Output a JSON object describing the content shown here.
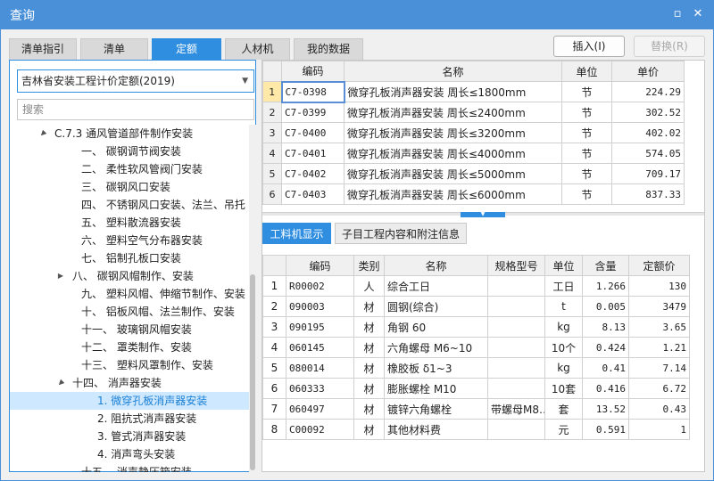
{
  "window": {
    "title": "查询",
    "minimize_glyph": "▫",
    "close_glyph": "✕"
  },
  "tabs": [
    {
      "label": "清单指引",
      "active": false
    },
    {
      "label": "清单",
      "active": false
    },
    {
      "label": "定额",
      "active": true
    },
    {
      "label": "人材机",
      "active": false
    },
    {
      "label": "我的数据",
      "active": false
    }
  ],
  "buttons": {
    "insert": "插入(I)",
    "replace": "替换(R)"
  },
  "left": {
    "library": "吉林省安装工程计价定额(2019)",
    "search_placeholder": "搜索",
    "tree": [
      {
        "label": "C.7.3 通风管道部件制作安装",
        "expand": "▲",
        "level": 0
      },
      {
        "label": "一、 碳钢调节阀安装",
        "expand": "",
        "level": 1
      },
      {
        "label": "二、 柔性软风管阀门安装",
        "expand": "",
        "level": 1
      },
      {
        "label": "三、 碳钢风口安装",
        "expand": "",
        "level": 1
      },
      {
        "label": "四、 不锈钢风口安装、法兰、吊托",
        "expand": "",
        "level": 1
      },
      {
        "label": "五、 塑料散流器安装",
        "expand": "",
        "level": 1
      },
      {
        "label": "六、 塑料空气分布器安装",
        "expand": "",
        "level": 1
      },
      {
        "label": "七、 铝制孔板口安装",
        "expand": "",
        "level": 1
      },
      {
        "label": "八、 碳钢风帽制作、安装",
        "expand": "▶",
        "level": 1
      },
      {
        "label": "九、 塑料风帽、伸缩节制作、安装",
        "expand": "",
        "level": 1
      },
      {
        "label": "十、 铝板风帽、法兰制作、安装",
        "expand": "",
        "level": 1
      },
      {
        "label": "十一、 玻璃钢风帽安装",
        "expand": "",
        "level": 1
      },
      {
        "label": "十二、 罩类制作、安装",
        "expand": "",
        "level": 1
      },
      {
        "label": "十三、 塑料风罩制作、安装",
        "expand": "",
        "level": 1
      },
      {
        "label": "十四、 消声器安装",
        "expand": "▲",
        "level": 1
      },
      {
        "label": "1. 微穿孔板消声器安装",
        "expand": "",
        "level": 2,
        "selected": true
      },
      {
        "label": "2. 阻抗式消声器安装",
        "expand": "",
        "level": 2
      },
      {
        "label": "3. 管式消声器安装",
        "expand": "",
        "level": 2
      },
      {
        "label": "4. 消声弯头安装",
        "expand": "",
        "level": 2
      },
      {
        "label": "十五、 消声静压箱安装",
        "expand": "",
        "level": 1
      }
    ]
  },
  "quota_table": {
    "headers": [
      "编码",
      "名称",
      "单位",
      "单价"
    ],
    "rows": [
      {
        "no": "1",
        "code": "C7-0398",
        "name": "微穿孔板消声器安装 周长≤1800mm",
        "unit": "节",
        "price": "224.29"
      },
      {
        "no": "2",
        "code": "C7-0399",
        "name": "微穿孔板消声器安装 周长≤2400mm",
        "unit": "节",
        "price": "302.52"
      },
      {
        "no": "3",
        "code": "C7-0400",
        "name": "微穿孔板消声器安装 周长≤3200mm",
        "unit": "节",
        "price": "402.02"
      },
      {
        "no": "4",
        "code": "C7-0401",
        "name": "微穿孔板消声器安装 周长≤4000mm",
        "unit": "节",
        "price": "574.05"
      },
      {
        "no": "5",
        "code": "C7-0402",
        "name": "微穿孔板消声器安装 周长≤5000mm",
        "unit": "节",
        "price": "709.17"
      },
      {
        "no": "6",
        "code": "C7-0403",
        "name": "微穿孔板消声器安装 周长≤6000mm",
        "unit": "节",
        "price": "837.33"
      }
    ]
  },
  "subtabs": [
    {
      "label": "工料机显示",
      "active": true
    },
    {
      "label": "子目工程内容和附注信息",
      "active": false
    }
  ],
  "material_table": {
    "headers": [
      "编码",
      "类别",
      "名称",
      "规格型号",
      "单位",
      "含量",
      "定额价"
    ],
    "rows": [
      {
        "no": "1",
        "code": "R00002",
        "cat": "人",
        "name": "综合工日",
        "spec": "",
        "unit": "工日",
        "qty": "1.266",
        "price": "130"
      },
      {
        "no": "2",
        "code": "090003",
        "cat": "材",
        "name": "圆钢(综合)",
        "spec": "",
        "unit": "t",
        "qty": "0.005",
        "price": "3479"
      },
      {
        "no": "3",
        "code": "090195",
        "cat": "材",
        "name": "角钢 60",
        "spec": "",
        "unit": "kg",
        "qty": "8.13",
        "price": "3.65"
      },
      {
        "no": "4",
        "code": "060145",
        "cat": "材",
        "name": "六角螺母 M6~10",
        "spec": "",
        "unit": "10个",
        "qty": "0.424",
        "price": "1.21"
      },
      {
        "no": "5",
        "code": "080014",
        "cat": "材",
        "name": "橡胶板 δ1~3",
        "spec": "",
        "unit": "kg",
        "qty": "0.41",
        "price": "7.14"
      },
      {
        "no": "6",
        "code": "060333",
        "cat": "材",
        "name": "膨胀螺栓 M10",
        "spec": "",
        "unit": "10套",
        "qty": "0.416",
        "price": "6.72"
      },
      {
        "no": "7",
        "code": "060497",
        "cat": "材",
        "name": "镀锌六角螺栓",
        "spec": "带螺母M8…",
        "unit": "套",
        "qty": "13.52",
        "price": "0.43"
      },
      {
        "no": "8",
        "code": "C00092",
        "cat": "材",
        "name": "其他材料费",
        "spec": "",
        "unit": "元",
        "qty": "0.591",
        "price": "1"
      }
    ]
  },
  "colors": {
    "accent": "#2f8ee0",
    "titlebar": "#4a90d9",
    "selected_row": "#cde8ff"
  }
}
